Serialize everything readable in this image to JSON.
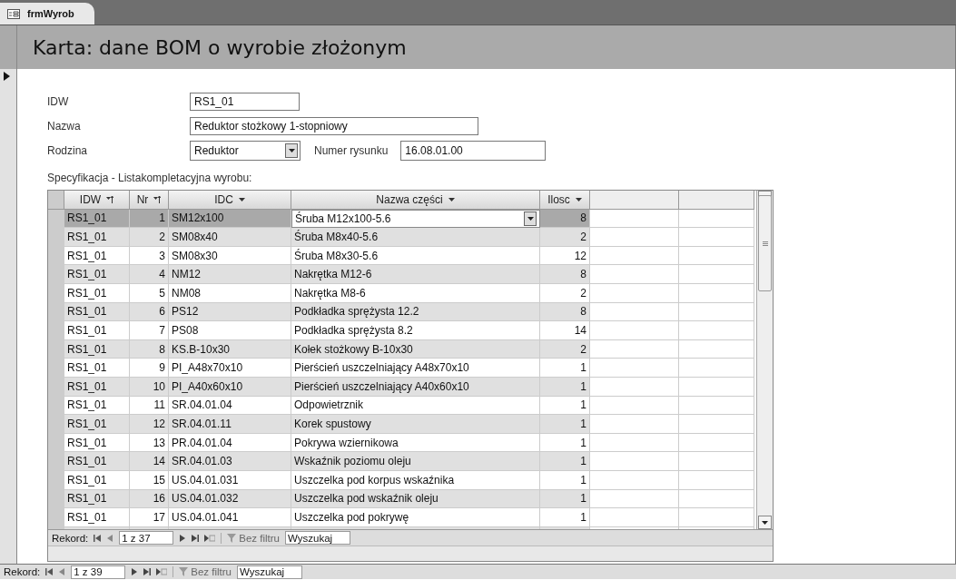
{
  "document_tab": {
    "label": "frmWyrob"
  },
  "form": {
    "title": "Karta: dane BOM o wyrobie złożonym",
    "fields": [
      {
        "label": "IDW",
        "value": "RS1_01"
      },
      {
        "label": "Nazwa",
        "value": "Reduktor stożkowy 1-stopniowy"
      }
    ],
    "family": {
      "label": "Rodzina",
      "value": "Reduktor"
    },
    "drawing_number": {
      "label": "Numer rysunku",
      "value": "16.08.01.00"
    },
    "subform_label": "Specyfikacja - Listakompletacyjna wyrobu:"
  },
  "table": {
    "columns": [
      {
        "label": "IDW",
        "sorted": true
      },
      {
        "label": "Nr",
        "sorted": true
      },
      {
        "label": "IDC",
        "sorted": false
      },
      {
        "label": "Nazwa części",
        "sorted": false
      },
      {
        "label": "Ilosc",
        "sorted": false
      }
    ],
    "rows": [
      {
        "idw": "RS1_01",
        "nr": "1",
        "idc": "SM12x100",
        "name": "Śruba M12x100-5.6",
        "qty": "8",
        "selected": true
      },
      {
        "idw": "RS1_01",
        "nr": "2",
        "idc": "SM08x40",
        "name": "Śruba M8x40-5.6",
        "qty": "2",
        "selected": false
      },
      {
        "idw": "RS1_01",
        "nr": "3",
        "idc": "SM08x30",
        "name": "Śruba M8x30-5.6",
        "qty": "12",
        "selected": false
      },
      {
        "idw": "RS1_01",
        "nr": "4",
        "idc": "NM12",
        "name": "Nakrętka M12-6",
        "qty": "8",
        "selected": false
      },
      {
        "idw": "RS1_01",
        "nr": "5",
        "idc": "NM08",
        "name": "Nakrętka M8-6",
        "qty": "2",
        "selected": false
      },
      {
        "idw": "RS1_01",
        "nr": "6",
        "idc": "PS12",
        "name": "Podkładka sprężysta 12.2",
        "qty": "8",
        "selected": false
      },
      {
        "idw": "RS1_01",
        "nr": "7",
        "idc": "PS08",
        "name": "Podkładka sprężysta 8.2",
        "qty": "14",
        "selected": false
      },
      {
        "idw": "RS1_01",
        "nr": "8",
        "idc": "KS.B-10x30",
        "name": "Kołek stożkowy B-10x30",
        "qty": "2",
        "selected": false
      },
      {
        "idw": "RS1_01",
        "nr": "9",
        "idc": "PI_A48x70x10",
        "name": "Pierścień uszczelniający A48x70x10",
        "qty": "1",
        "selected": false
      },
      {
        "idw": "RS1_01",
        "nr": "10",
        "idc": "PI_A40x60x10",
        "name": "Pierścień uszczelniający A40x60x10",
        "qty": "1",
        "selected": false
      },
      {
        "idw": "RS1_01",
        "nr": "11",
        "idc": "SR.04.01.04",
        "name": "Odpowietrznik",
        "qty": "1",
        "selected": false
      },
      {
        "idw": "RS1_01",
        "nr": "12",
        "idc": "SR.04.01.11",
        "name": "Korek spustowy",
        "qty": "1",
        "selected": false
      },
      {
        "idw": "RS1_01",
        "nr": "13",
        "idc": "PR.04.01.04",
        "name": "Pokrywa wziernikowa",
        "qty": "1",
        "selected": false
      },
      {
        "idw": "RS1_01",
        "nr": "14",
        "idc": "SR.04.01.03",
        "name": "Wskaźnik poziomu oleju",
        "qty": "1",
        "selected": false
      },
      {
        "idw": "RS1_01",
        "nr": "15",
        "idc": "US.04.01.031",
        "name": "Uszczelka pod korpus wskaźnika",
        "qty": "1",
        "selected": false
      },
      {
        "idw": "RS1_01",
        "nr": "16",
        "idc": "US.04.01.032",
        "name": "Uszczelka pod wskaźnik oleju",
        "qty": "1",
        "selected": false
      },
      {
        "idw": "RS1_01",
        "nr": "17",
        "idc": "US.04.01.041",
        "name": "Uszczelka pod pokrywę",
        "qty": "1",
        "selected": false
      }
    ],
    "navigator": {
      "label": "Rekord:",
      "position": "1 z 37",
      "filter": "Bez filtru",
      "search": "Wyszukaj"
    }
  },
  "navigator": {
    "label": "Rekord:",
    "position": "1 z 39",
    "filter": "Bez filtru",
    "search": "Wyszukaj"
  }
}
